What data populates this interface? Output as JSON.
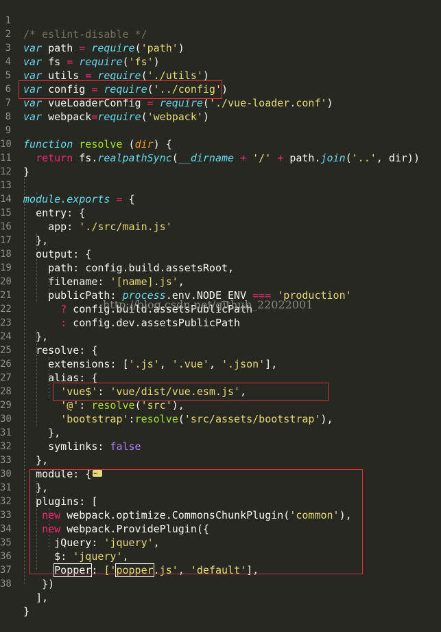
{
  "editor": {
    "lines": [
      {
        "n": "1"
      },
      {
        "n": "2"
      },
      {
        "n": "3"
      },
      {
        "n": "4"
      },
      {
        "n": "5"
      },
      {
        "n": "6"
      },
      {
        "n": "7"
      },
      {
        "n": "8"
      },
      {
        "n": "9"
      },
      {
        "n": "10"
      },
      {
        "n": "11"
      },
      {
        "n": "12"
      },
      {
        "n": "13"
      },
      {
        "n": "14"
      },
      {
        "n": "15"
      },
      {
        "n": "16"
      },
      {
        "n": "17"
      },
      {
        "n": "18"
      },
      {
        "n": "19"
      },
      {
        "n": "20"
      },
      {
        "n": "21"
      },
      {
        "n": "22"
      },
      {
        "n": "23"
      },
      {
        "n": "24"
      },
      {
        "n": "25"
      },
      {
        "n": "26"
      },
      {
        "n": "27"
      },
      {
        "n": "28"
      },
      {
        "n": "29"
      },
      {
        "n": "30"
      },
      {
        "n": "31"
      },
      {
        "n": "32"
      },
      {
        "n": "33"
      },
      {
        "n": "30"
      },
      {
        "n": "31"
      },
      {
        "n": "32"
      },
      {
        "n": "33"
      },
      {
        "n": "34"
      },
      {
        "n": "35"
      },
      {
        "n": "36"
      },
      {
        "n": "37"
      },
      {
        "n": "38"
      }
    ],
    "tokens": {
      "comment_eslint": "/* eslint-disable */",
      "var": "var",
      "path": "path",
      "fs": "fs",
      "utils": "utils",
      "config": "config",
      "vueLoaderConfig": "vueLoaderConfig",
      "webpack": "webpack",
      "eq": "=",
      "require": "require",
      "paren_open": "(",
      "paren_close": ")",
      "str_path": "'path'",
      "str_fs": "'fs'",
      "str_utils": "'./utils'",
      "str_config": "'../config'",
      "str_vueloader": "'./vue-loader.conf'",
      "str_webpack": "'webpack'",
      "function": "function",
      "resolve": "resolve",
      "dir": "dir",
      "brace_open": "{",
      "brace_close": "}",
      "return": "return",
      "fs_dot": "fs.",
      "realpathSync": "realpathSync",
      "dirname": "__dirname",
      "plus": "+",
      "str_slash": "'/'",
      "path_dot": "path.",
      "join": "join",
      "str_dotdot": "'..'",
      "comma_dir": ", dir))",
      "module": "module",
      "exports": ".exports",
      "entry": "entry",
      "colon_brace": ": {",
      "app": "app",
      "colon": ":",
      "str_main": "'./src/main.js'",
      "brace_close_comma": "},",
      "output": "output",
      "config_assets_root": "config.build.assetsRoot,",
      "filename": "filename",
      "str_name": "'[name].js'",
      "comma": ",",
      "publicPath": "publicPath",
      "process": "process",
      "env_dot": ".env.",
      "node_env": "NODE_ENV",
      "triple_eq": "===",
      "str_production": "'production'",
      "question": "?",
      "config_build_pub": "config.build.assetsPublicPath",
      "config_dev_pub": "config.dev.assetsPublicPath",
      "extensions": "extensions",
      "ext_open": ": [",
      "str_js": "'.js'",
      "str_vue": "'.vue'",
      "str_json": "'.json'",
      "ext_close": "],",
      "alias": "alias",
      "str_vue_key": "'vue$'",
      "str_vue_esm": "'vue/dist/vue.esm.js'",
      "str_at": "'@'",
      "str_src": "'src'",
      "paren_close_comma": "),",
      "str_bootstrap": "'bootstrap'",
      "str_bootstrap_path": "'src/assets/bootstrap'",
      "symlinks": "symlinks",
      "false": "false",
      "module_key": "module",
      "plugins": "plugins",
      "bracket_open": ": [",
      "new": "new",
      "webpack_optimize": "webpack.optimize.CommonsChunkPlugin",
      "str_common": "'common'",
      "webpack_provide": "webpack.ProvidePlugin",
      "paren_brace": "({",
      "jquery_key": "jQuery",
      "str_jquery": "'jquery'",
      "dollar": "$",
      "popper_key": "Popper",
      "bracket_q": "['",
      "popper": "popper",
      "js_q": ".js'",
      "str_default": "'default'",
      "bracket_close_comma": "],",
      "close_paren_brace": "})",
      "bracket_close": "],",
      "brace_final": "}"
    },
    "watermark": "http://blog.csdn.net/github_22022001"
  },
  "colors": {
    "background": "#272822",
    "highlight_box": "#e03434"
  }
}
